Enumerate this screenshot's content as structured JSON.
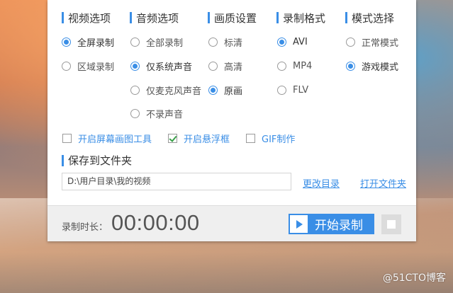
{
  "sections": {
    "video": {
      "title": "视频选项",
      "options": [
        "全屏录制",
        "区域录制"
      ],
      "selected": "全屏录制"
    },
    "audio": {
      "title": "音频选项",
      "options": [
        "全部录制",
        "仅系统声音",
        "仅麦克风声音",
        "不录声音"
      ],
      "selected": "仅系统声音"
    },
    "quality": {
      "title": "画质设置",
      "options": [
        "标清",
        "高清",
        "原画"
      ],
      "selected": "原画"
    },
    "format": {
      "title": "录制格式",
      "options": [
        "AVI",
        "MP4",
        "FLV"
      ],
      "selected": "AVI"
    },
    "mode": {
      "title": "模式选择",
      "options": [
        "正常模式",
        "游戏模式"
      ],
      "selected": "游戏模式"
    }
  },
  "checkboxes": {
    "screen_paint": {
      "label": "开启屏幕画图工具",
      "checked": false
    },
    "float_window": {
      "label": "开启悬浮框",
      "checked": true
    },
    "gif": {
      "label": "GIF制作",
      "checked": false
    }
  },
  "save": {
    "title": "保存到文件夹",
    "path": "D:\\用户目录\\我的视频",
    "change_dir": "更改目录",
    "open_folder": "打开文件夹"
  },
  "footer": {
    "duration_label": "录制时长：",
    "timer": "00:00:00",
    "start_label": "开始录制"
  },
  "watermark": "@51CTO博客",
  "colors": {
    "accent": "#3a8ee6",
    "check_green": "#3aa04a"
  }
}
